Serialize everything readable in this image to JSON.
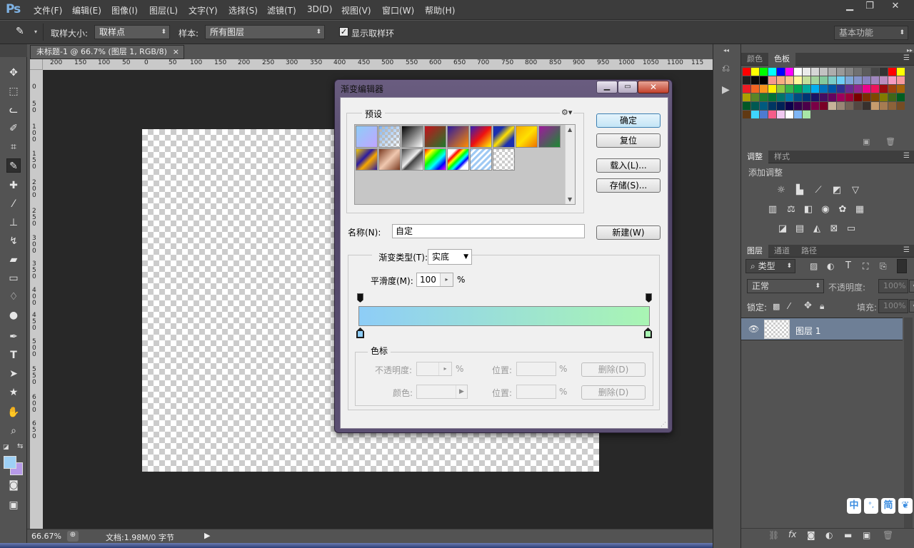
{
  "app": {
    "logo": "Ps"
  },
  "menu": [
    "文件(F)",
    "编辑(E)",
    "图像(I)",
    "图层(L)",
    "文字(Y)",
    "选择(S)",
    "滤镜(T)",
    "3D(D)",
    "视图(V)",
    "窗口(W)",
    "帮助(H)"
  ],
  "window_controls": {
    "minimize": "▁",
    "restore": "❐",
    "close": "✕"
  },
  "options_bar": {
    "sample_size_label": "取样大小:",
    "sample_size_value": "取样点",
    "sample_label": "样本:",
    "sample_value": "所有图层",
    "show_ring_label": "显示取样环",
    "show_ring_checked": true,
    "workspace_value": "基本功能"
  },
  "document": {
    "tab_title": "未标题-1 @ 66.7% (图层 1, RGB/8)",
    "tab_close": "×",
    "ruler_h": [
      "200",
      "150",
      "100",
      "50",
      "0",
      "50",
      "100",
      "150",
      "200",
      "250",
      "300",
      "350",
      "400",
      "450",
      "500",
      "550",
      "600",
      "650",
      "700",
      "750",
      "800",
      "850",
      "900",
      "950",
      "1000",
      "1050",
      "1100",
      "115"
    ],
    "ruler_v": [
      "0",
      "50",
      "100",
      "150",
      "200",
      "250",
      "300",
      "350",
      "400",
      "450",
      "500",
      "550",
      "600",
      "650"
    ]
  },
  "status": {
    "zoom": "66.67%",
    "doc_info": "文档:1.98M/0 字节"
  },
  "panels": {
    "swatch_tabs": [
      "颜色",
      "色板"
    ],
    "adjust_tabs": [
      "调整",
      "样式"
    ],
    "adjust_title": "添加调整",
    "layers_tabs": [
      "图层",
      "通道",
      "路径"
    ],
    "layer_filter": "类型",
    "blend_mode": "正常",
    "opacity_label": "不透明度:",
    "opacity_value": "100%",
    "lock_label": "锁定:",
    "fill_label": "填充:",
    "fill_value": "100%",
    "layer_name": "图层 1"
  },
  "ime": [
    "中",
    "°,",
    "简"
  ],
  "dialog": {
    "title": "渐变编辑器",
    "presets_label": "预设",
    "ok": "确定",
    "reset": "复位",
    "load": "载入(L)...",
    "save": "存储(S)...",
    "name_label": "名称(N):",
    "name_value": "自定",
    "new_button": "新建(W)",
    "gradient_type_label": "渐变类型(T):",
    "gradient_type_value": "实底",
    "smoothness_label": "平滑度(M):",
    "smoothness_value": "100",
    "percent": "%",
    "stops_label": "色标",
    "opacity_label": "不透明度:",
    "position_label": "位置:",
    "color_label": "颜色:",
    "delete_button": "删除(D)",
    "gradient_start_color": "#8ecdf7",
    "gradient_end_color": "#a9f5b3"
  }
}
